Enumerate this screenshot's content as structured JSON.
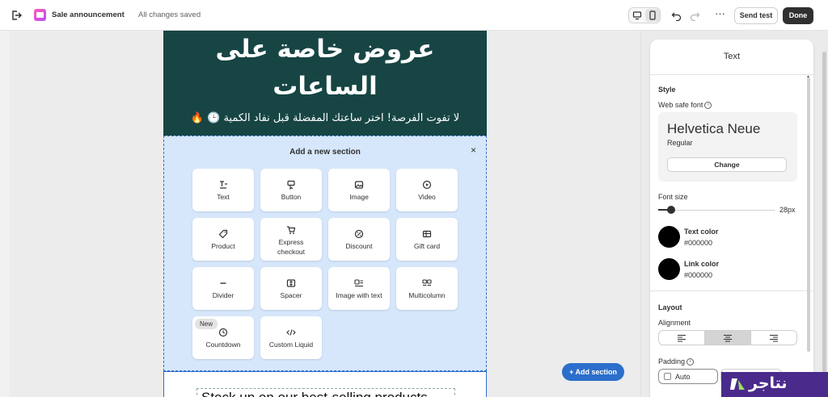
{
  "topbar": {
    "title": "Sale announcement",
    "status": "All changes saved",
    "send_test_label": "Send test",
    "done_label": "Done",
    "more_label": "···"
  },
  "email": {
    "hero_title": "عروض خاصة على الساعات",
    "hero_subtitle": "لا تفوت الفرصة! اختر ساعتك المفضلة قبل نفاد الكمية 🕒 🔥",
    "hero_bg": "#174544",
    "next_block_text": "Stock up on our best-selling products"
  },
  "add_section": {
    "title": "Add a new section",
    "close_label": "×",
    "tiles": [
      {
        "label": "Text",
        "icon": "text-icon"
      },
      {
        "label": "Button",
        "icon": "button-icon"
      },
      {
        "label": "Image",
        "icon": "image-icon"
      },
      {
        "label": "Video",
        "icon": "video-icon"
      },
      {
        "label": "Product",
        "icon": "tag-icon"
      },
      {
        "label": "Express checkout",
        "icon": "cart-icon"
      },
      {
        "label": "Discount",
        "icon": "discount-icon"
      },
      {
        "label": "Gift card",
        "icon": "gift-card-icon"
      },
      {
        "label": "Divider",
        "icon": "divider-icon"
      },
      {
        "label": "Spacer",
        "icon": "spacer-icon"
      },
      {
        "label": "Image with text",
        "icon": "image-with-text-icon"
      },
      {
        "label": "Multicolumn",
        "icon": "multicolumn-icon"
      },
      {
        "label": "Countdown",
        "icon": "clock-icon",
        "badge": "New"
      },
      {
        "label": "Custom Liquid",
        "icon": "code-icon"
      }
    ]
  },
  "add_section_button": "Add section",
  "panel": {
    "title": "Text",
    "style_heading": "Style",
    "web_safe_font_label": "Web safe font",
    "font_name": "Helvetica Neue",
    "font_style": "Regular",
    "change_label": "Change",
    "font_size_label": "Font size",
    "font_size_value": "28px",
    "font_size_level": 0.1,
    "text_color_label": "Text color",
    "text_color_value": "#000000",
    "link_color_label": "Link color",
    "link_color_value": "#000000",
    "layout_heading": "Layout",
    "alignment_label": "Alignment",
    "alignment_selected": "center",
    "padding_label": "Padding",
    "padding_value": "Auto"
  },
  "watermark": {
    "text": "نتاجر"
  },
  "colors": {
    "accent": "#2c6ecb",
    "dark_button": "#303030",
    "watermark_bg": "#4a2b8c"
  }
}
